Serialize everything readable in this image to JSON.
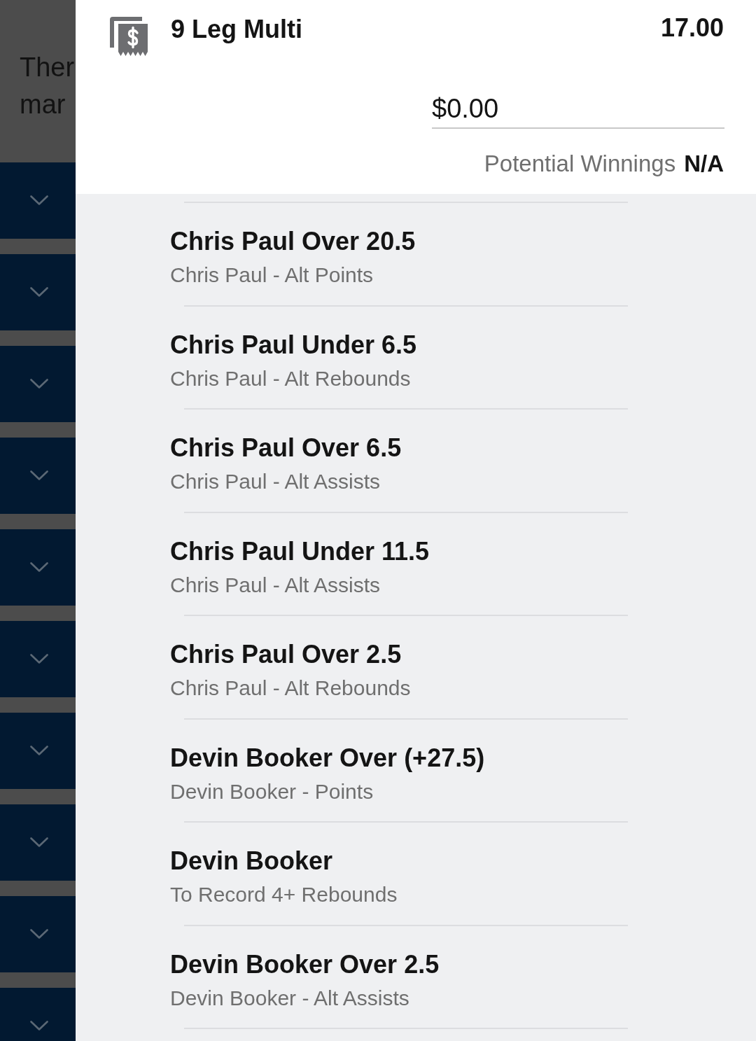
{
  "background": {
    "notice_lines": [
      "Ther",
      "mar"
    ],
    "sections": [
      {
        "expanded": false
      },
      {
        "expanded": false
      },
      {
        "expanded": false
      },
      {
        "expanded": false
      },
      {
        "expanded": false
      },
      {
        "expanded": false
      },
      {
        "expanded": false
      },
      {
        "expanded": false
      },
      {
        "expanded": false
      },
      {
        "expanded": false
      }
    ]
  },
  "bet_slip": {
    "title": "9 Leg Multi",
    "odds": "17.00",
    "stake": {
      "value": "$0.00"
    },
    "potential_winnings": {
      "label": "Potential Winnings",
      "value": "N/A"
    },
    "legs": [
      {
        "selection": "Chris Paul Over 20.5",
        "market": "Chris Paul - Alt Points"
      },
      {
        "selection": "Chris Paul Under 6.5",
        "market": "Chris Paul - Alt Rebounds"
      },
      {
        "selection": "Chris Paul Over 6.5",
        "market": "Chris Paul - Alt Assists"
      },
      {
        "selection": "Chris Paul Under 11.5",
        "market": "Chris Paul - Alt Assists"
      },
      {
        "selection": "Chris Paul Over 2.5",
        "market": "Chris Paul - Alt Rebounds"
      },
      {
        "selection": "Devin Booker Over (+27.5)",
        "market": "Devin Booker - Points"
      },
      {
        "selection": "Devin Booker",
        "market": "To Record 4+ Rebounds"
      },
      {
        "selection": "Devin Booker Over 2.5",
        "market": "Devin Booker - Alt Assists"
      }
    ]
  }
}
